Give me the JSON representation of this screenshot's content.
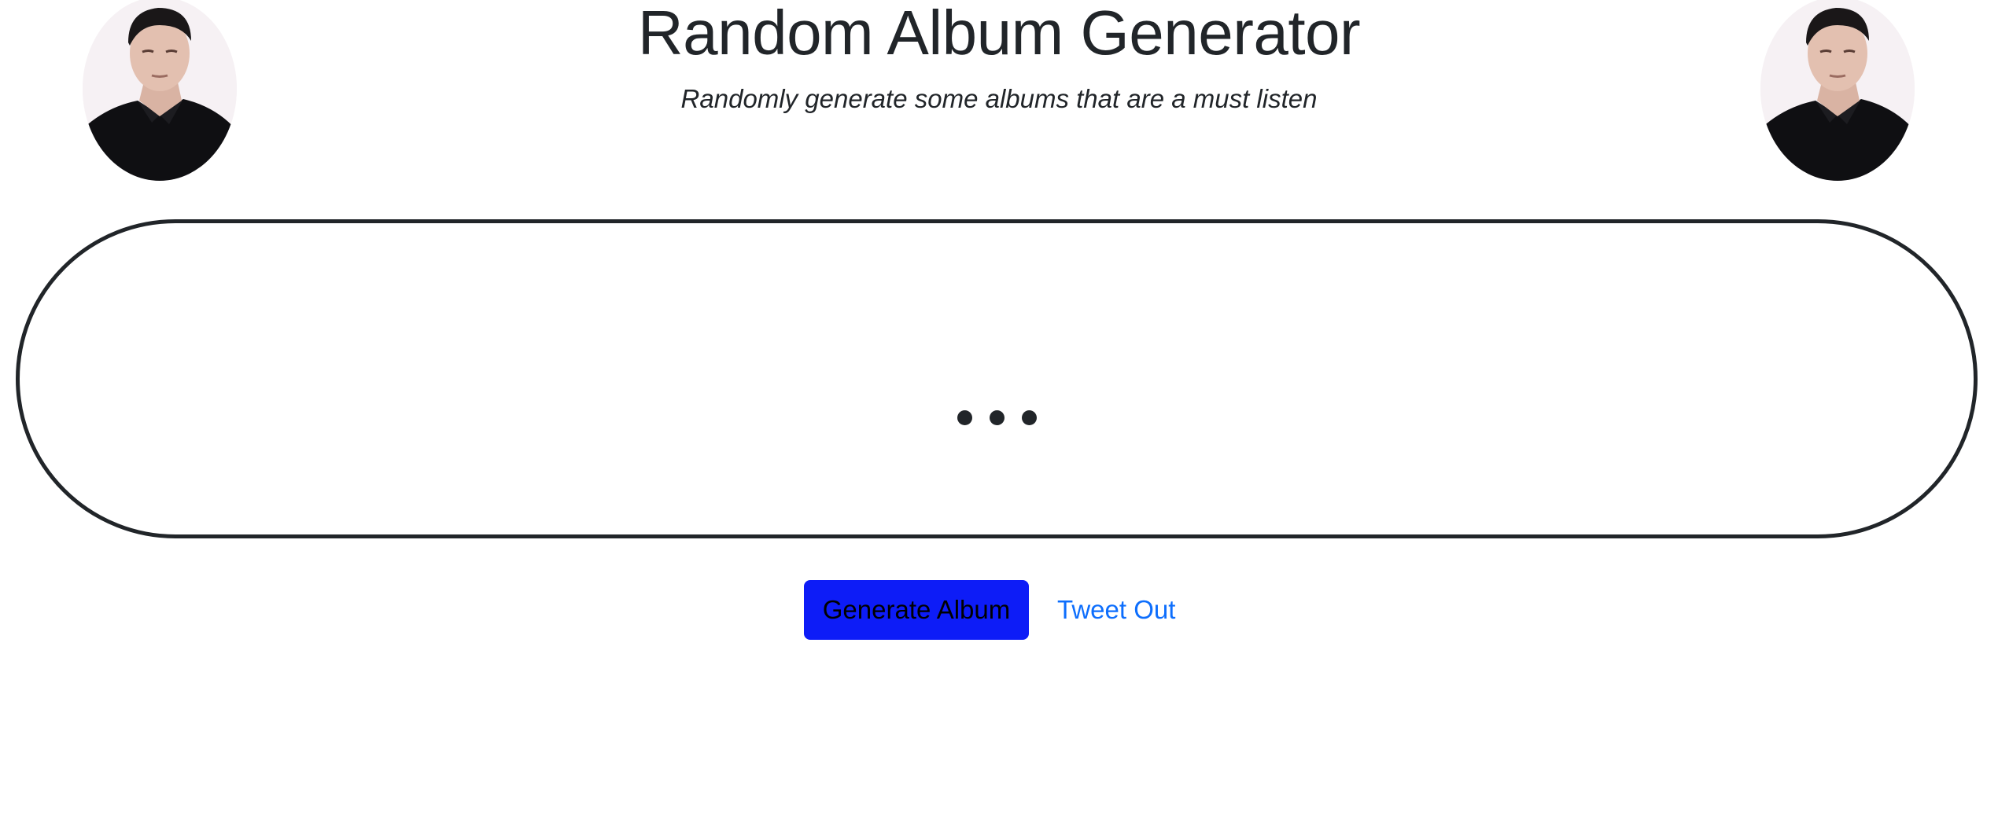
{
  "header": {
    "title": "Random Album Generator",
    "subtitle": "Randomly generate some albums that are a must listen"
  },
  "display": {
    "state": "loading"
  },
  "actions": {
    "generate_label": "Generate Album",
    "tweet_label": "Tweet Out"
  },
  "colors": {
    "primary_button": "#0d1cf7",
    "link": "#0d6efd",
    "text": "#212529",
    "border": "#212529"
  },
  "icons": [
    "avatar-photo-left",
    "avatar-photo-right",
    "loading-dots-icon"
  ]
}
